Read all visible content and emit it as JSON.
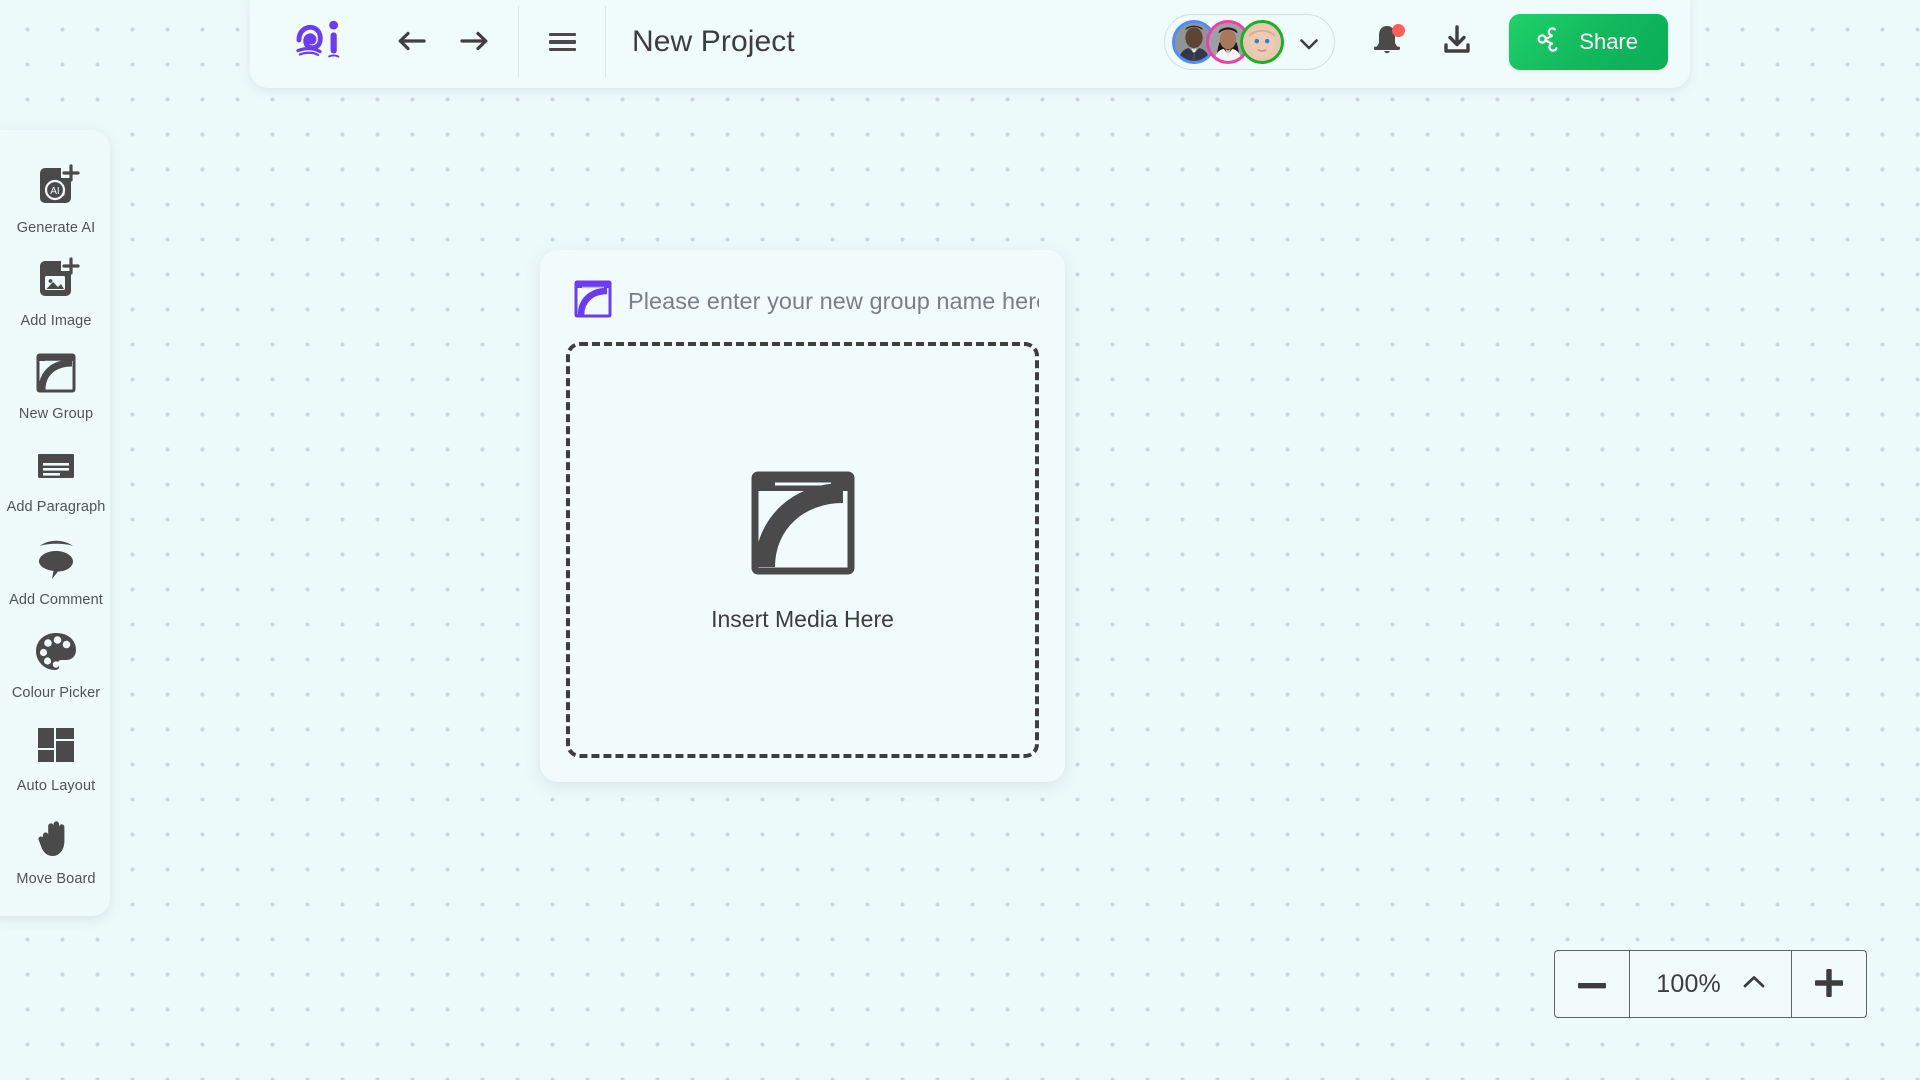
{
  "app": {
    "background_color": "#edfafa",
    "accent_purple": "#6c3cf4",
    "share_green": "#12b95d",
    "dot_color": "#cdd5dd"
  },
  "topbar": {
    "logo_name": "ai-logo",
    "undo_label": "Undo",
    "redo_label": "Redo",
    "menu_label": "Menu",
    "project_title": "New Project",
    "avatars": [
      {
        "name": "collaborator-1",
        "ring_color": "#4b8ef7"
      },
      {
        "name": "collaborator-2",
        "ring_color": "#f23ea8"
      },
      {
        "name": "collaborator-3",
        "ring_color": "#16b21f"
      }
    ],
    "avatar_dropdown_label": "Show collaborators",
    "notifications_label": "Notifications",
    "has_notification": true,
    "download_label": "Download",
    "share_label": "Share"
  },
  "toolbar": {
    "items": [
      {
        "icon": "generate-ai-icon",
        "label": "Generate AI"
      },
      {
        "icon": "add-image-icon",
        "label": "Add Image"
      },
      {
        "icon": "new-group-icon",
        "label": "New Group"
      },
      {
        "icon": "add-paragraph-icon",
        "label": "Add Paragraph"
      },
      {
        "icon": "add-comment-icon",
        "label": "Add Comment"
      },
      {
        "icon": "colour-picker-icon",
        "label": "Colour Picker"
      },
      {
        "icon": "auto-layout-icon",
        "label": "Auto Layout"
      },
      {
        "icon": "move-board-icon",
        "label": "Move Board"
      }
    ]
  },
  "group_card": {
    "icon": "group-icon",
    "name_value": "",
    "name_placeholder": "Please enter your new group name here",
    "dropzone_icon": "media-frame-icon",
    "dropzone_label": "Insert Media Here"
  },
  "zoom_control": {
    "zoom_out_label": "−",
    "zoom_in_label": "+",
    "value": "100%",
    "expand_label": "Zoom options"
  }
}
